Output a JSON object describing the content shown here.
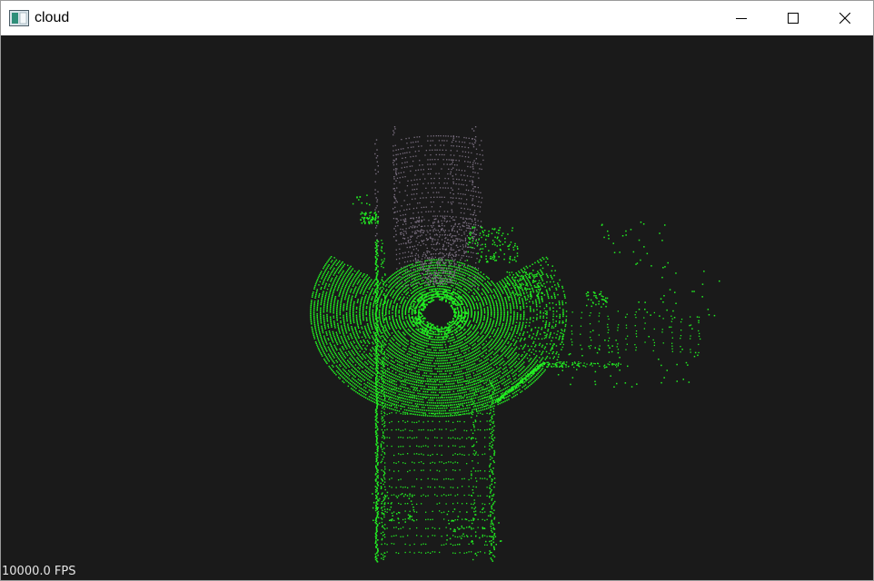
{
  "window": {
    "title": "cloud",
    "minimize_icon": "minimize-icon",
    "maximize_icon": "maximize-icon",
    "close_icon": "close-icon",
    "app_icon": "window-app-icon"
  },
  "viewer": {
    "background": "#1a1a1a",
    "point_color": "#22ee22",
    "far_point_color": "#7a6f80",
    "fps_text": "10000.0 FPS"
  }
}
